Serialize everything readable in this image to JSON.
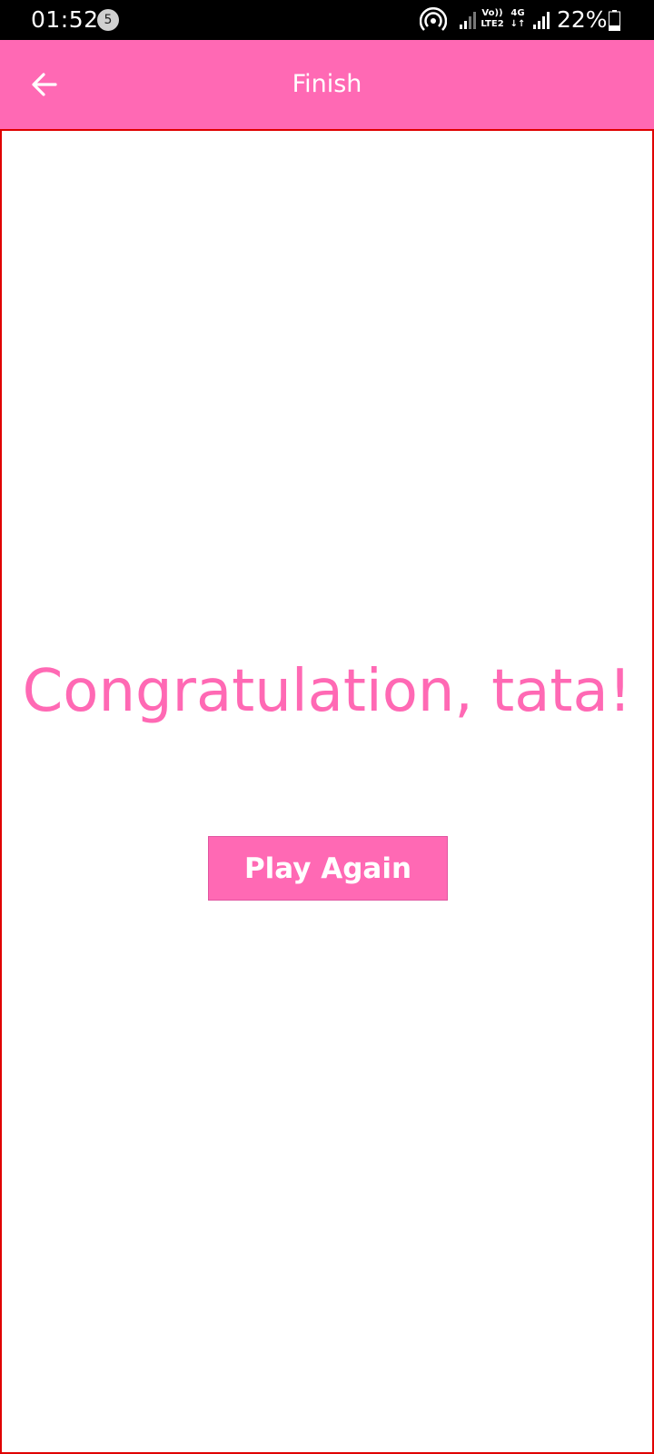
{
  "status_bar": {
    "time": "01:52",
    "notification_count": "5",
    "volte_label": "Vo))",
    "volte_sub": "LTE2",
    "network_label": "4G",
    "battery": "22%"
  },
  "app_bar": {
    "title": "Finish",
    "back_icon": "arrow-left-icon",
    "background_color": "#ff69b4"
  },
  "main": {
    "message": "Congratulation, tata!",
    "play_again_label": "Play Again",
    "accent_color": "#ff69b4"
  }
}
